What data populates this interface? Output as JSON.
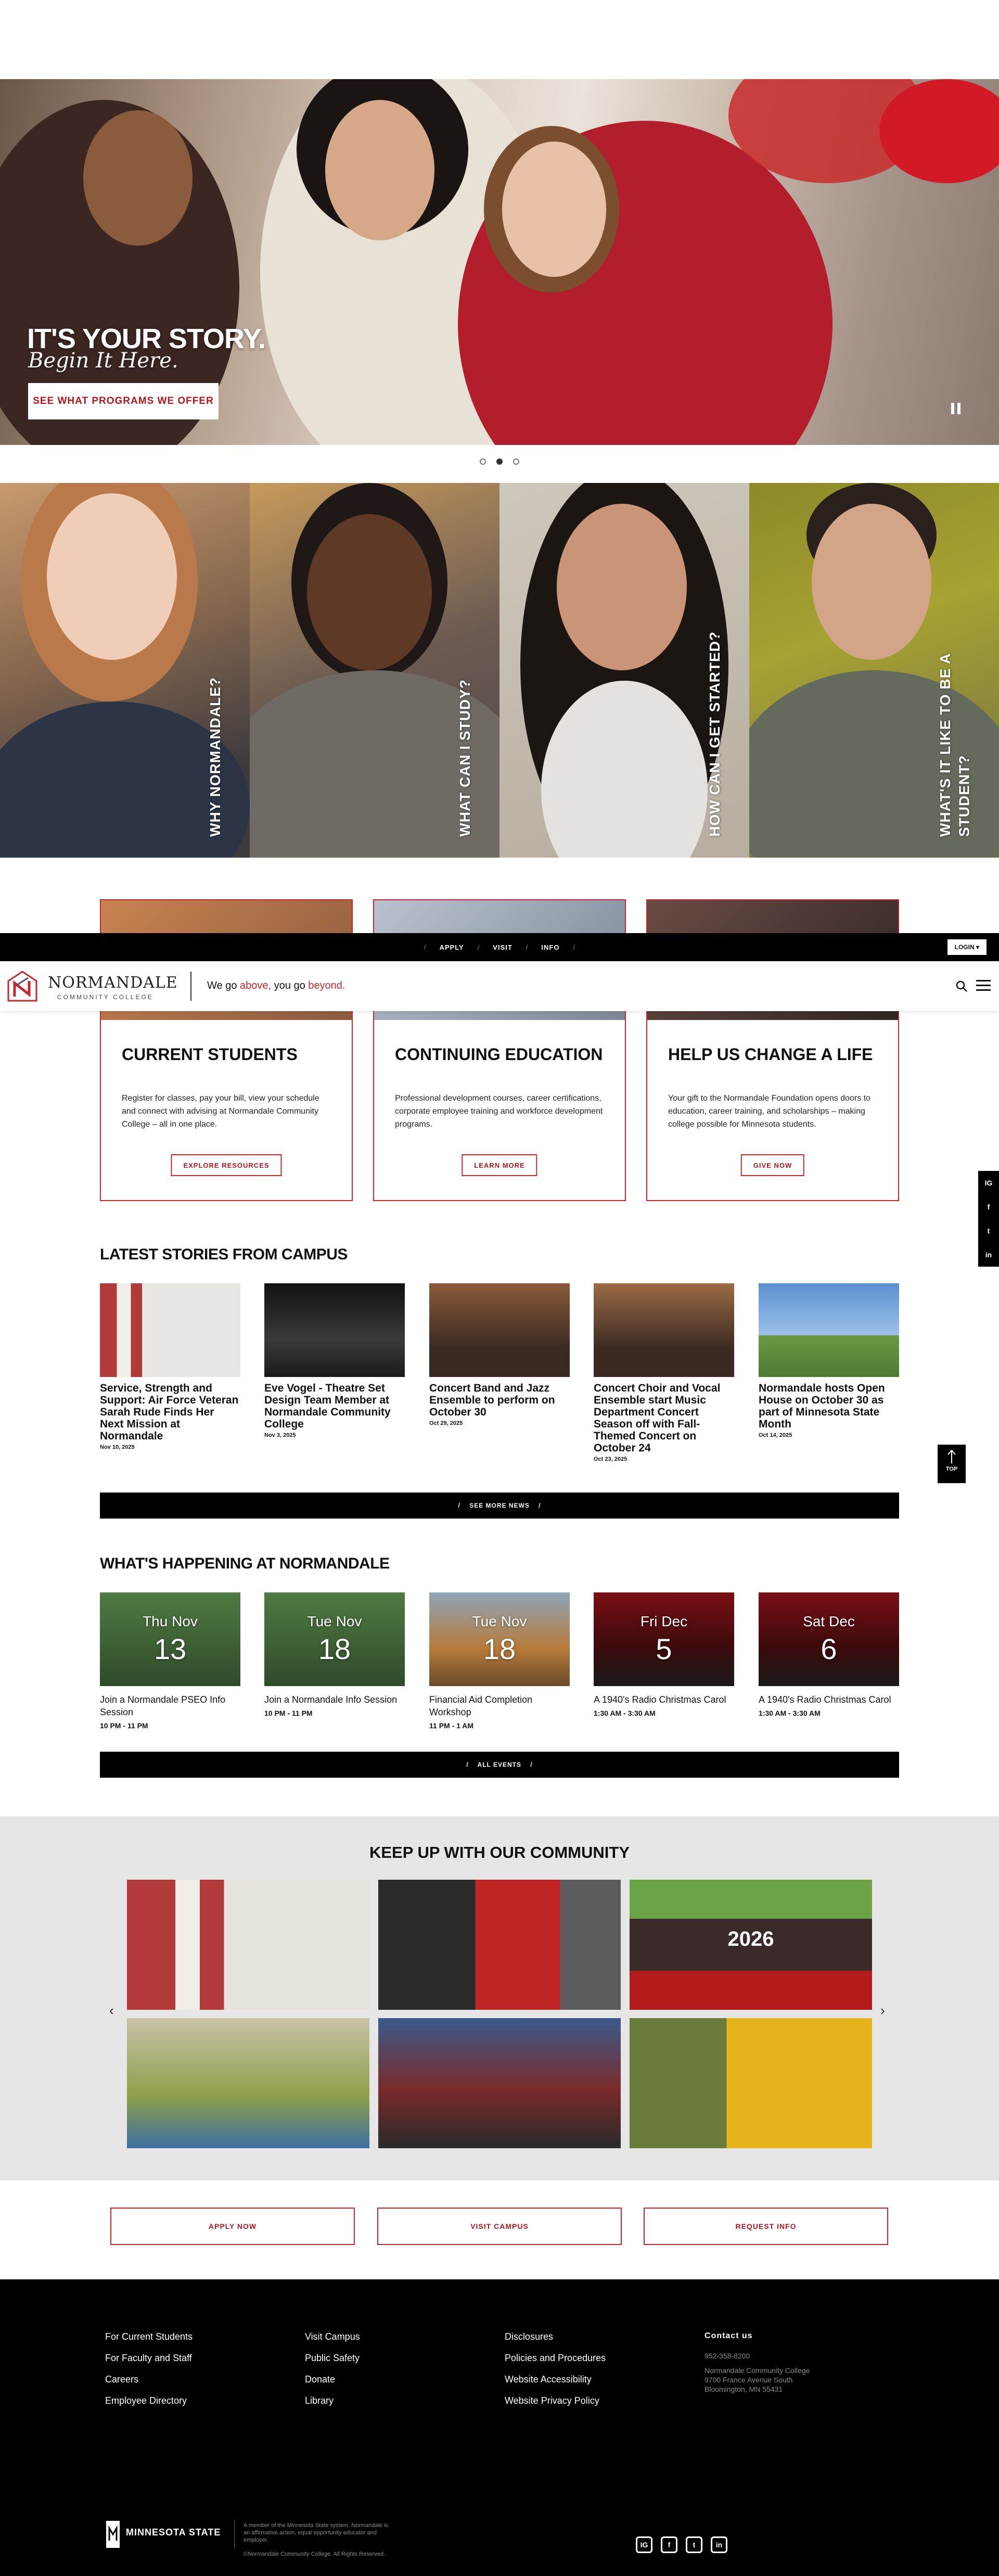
{
  "hero": {
    "title": "IT'S YOUR STORY.",
    "subtitle": "Begin It Here.",
    "cta": "SEE WHAT PROGRAMS WE OFFER"
  },
  "carousel": {
    "slide_count": 3,
    "active_index": 1
  },
  "panels": [
    {
      "label": "WHY NORMANDALE?"
    },
    {
      "label": "WHAT CAN I STUDY?"
    },
    {
      "label": "HOW CAN I GET STARTED?"
    },
    {
      "label": "WHAT'S IT LIKE TO BE A STUDENT?"
    }
  ],
  "cards": [
    {
      "title": "CURRENT STUDENTS",
      "text": "Register for classes, pay your bill, view your schedule and connect with advising at Normandale Community College – all in one place.",
      "button": "EXPLORE RESOURCES"
    },
    {
      "title": "CONTINUING EDUCATION",
      "text": "Professional development courses, career certifications, corporate employee training and workforce development programs.",
      "button": "LEARN MORE"
    },
    {
      "title": "HELP US CHANGE A LIFE",
      "text": "Your gift to the Normandale Foundation opens doors to education, career training, and scholarships – making college possible for Minnesota students.",
      "button": "GIVE NOW"
    }
  ],
  "topnav": {
    "items": [
      "APPLY",
      "VISIT",
      "INFO"
    ],
    "login": "LOGIN"
  },
  "header": {
    "logo_name": "NORMANDALE",
    "logo_sub": "COMMUNITY COLLEGE",
    "tagline_a": "We go",
    "tagline_b": "above,",
    "tagline_c": "you go",
    "tagline_d": "beyond."
  },
  "side_social": [
    "IG",
    "f",
    "t",
    "in"
  ],
  "top_button": "TOP",
  "stories": {
    "heading": "LATEST STORIES FROM CAMPUS",
    "items": [
      {
        "title": "Service, Strength and Support: Air Force Veteran Sarah Rude Finds Her Next Mission at Normandale",
        "date": "Nov 10, 2025"
      },
      {
        "title": "Eve Vogel - Theatre Set Design Team Member at Normandale Community College",
        "date": "Nov 3, 2025"
      },
      {
        "title": "Concert Band and Jazz Ensemble to perform on October 30",
        "date": "Oct 29, 2025"
      },
      {
        "title": "Concert Choir and Vocal Ensemble start Music Department Concert Season off with Fall-Themed Concert on October 24",
        "date": "Oct 23, 2025"
      },
      {
        "title": "Normandale hosts Open House on October 30 as part of Minnesota State Month",
        "date": "Oct 14, 2025"
      }
    ],
    "more": "SEE MORE NEWS"
  },
  "events": {
    "heading": "WHAT'S HAPPENING AT NORMANDALE",
    "items": [
      {
        "weekday_month": "Thu Nov",
        "day": "13",
        "title": "Join a Normandale PSEO Info Session",
        "time": "10 PM - 11 PM"
      },
      {
        "weekday_month": "Tue Nov",
        "day": "18",
        "title": "Join a Normandale Info Session",
        "time": "10 PM - 11 PM"
      },
      {
        "weekday_month": "Tue Nov",
        "day": "18",
        "title": "Financial Aid Completion Workshop",
        "time": "11 PM - 1 AM"
      },
      {
        "weekday_month": "Fri Dec",
        "day": "5",
        "title": "A 1940's Radio Christmas Carol",
        "time": "1:30 AM - 3:30 AM"
      },
      {
        "weekday_month": "Sat Dec",
        "day": "6",
        "title": "A 1940's Radio Christmas Carol",
        "time": "1:30 AM - 3:30 AM"
      }
    ],
    "more": "ALL EVENTS"
  },
  "community": {
    "heading": "KEEP UP WITH OUR COMMUNITY",
    "year_sign": "2026"
  },
  "cta_buttons": [
    "APPLY NOW",
    "VISIT CAMPUS",
    "REQUEST INFO"
  ],
  "footer": {
    "col1": [
      "For Current Students",
      "For Faculty and Staff",
      "Careers",
      "Employee Directory"
    ],
    "col2": [
      "Visit Campus",
      "Public Safety",
      "Donate",
      "Library"
    ],
    "col3": [
      "Disclosures",
      "Policies and Procedures",
      "Website Accessibility",
      "Website Privacy Policy"
    ],
    "contact_heading": "Contact us",
    "phone": "952-358-8200",
    "address1": "Normandale Community College",
    "address2": "9700 France Avenue South",
    "address3": "Bloomington, MN 55431",
    "ms_name": "MINNESOTA STATE",
    "ms_text": "A member of the Minnesota State system. Normandale is an affirmative action, equal opportunity educator and employer.",
    "copyright": "©Normandale Community College. All Rights Reserved.",
    "social": [
      "IG",
      "f",
      "t",
      "in"
    ]
  },
  "colors": {
    "brand_red": "#c8262c",
    "black": "#000000"
  }
}
